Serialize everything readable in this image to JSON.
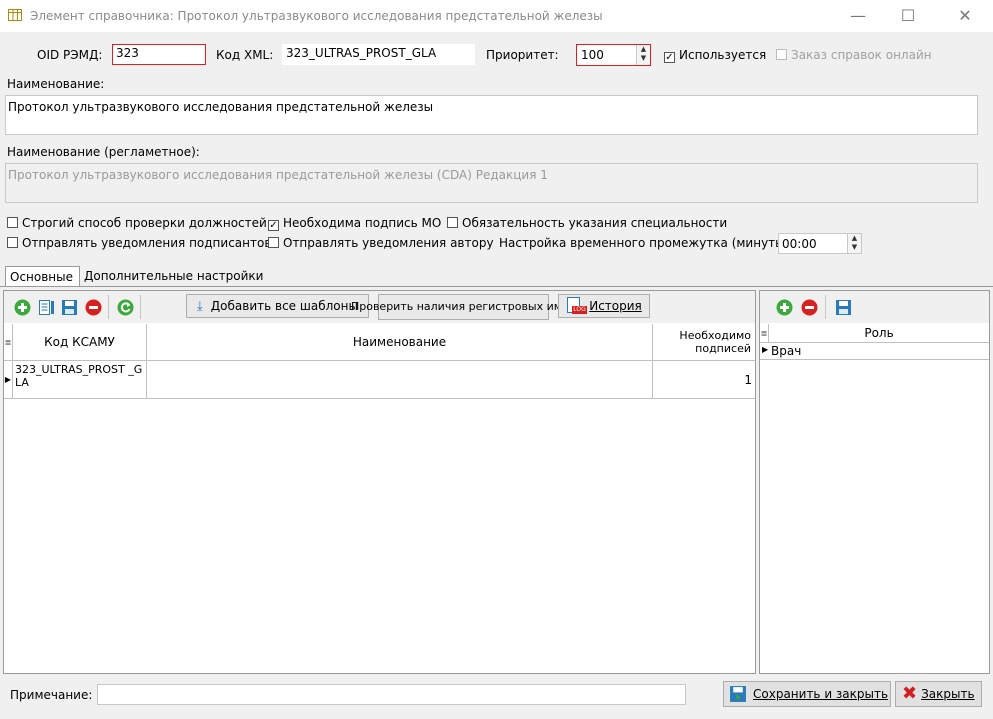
{
  "window": {
    "title": "Элемент справочника: Протокол ультразвукового исследования предстательной железы",
    "minimize": "—",
    "maximize": "☐",
    "close": "✕"
  },
  "header": {
    "oid_label": "OID РЭМД:",
    "oid_value": "323",
    "xml_label": "Код XML:",
    "xml_value": "323_ULTRAS_PROST_GLA",
    "priority_label": "Приоритет:",
    "priority_value": "100",
    "used_label": "Используется",
    "used_checked": true,
    "online_label": "Заказ справок онлайн",
    "online_checked": false
  },
  "name": {
    "label": "Наименование:",
    "value": "Протокол ультразвукового исследования предстательной железы"
  },
  "reg_name": {
    "label": "Наименование (регламетное):",
    "value": "Протокол ультразвукового исследования предстательной железы (CDA) Редакция 1"
  },
  "options": {
    "strict_check": "Строгий способ проверки должностей",
    "need_sign_mo": "Необходима подпись МО",
    "specialty_required": "Обязательность указания специальности",
    "notify_signers": "Отправлять уведомления подписантов",
    "notify_author": "Отправлять уведомления автору",
    "interval_label": "Настройка временного промежутка (минуты):",
    "interval_value": "00:00",
    "checked": {
      "need_sign_mo": true
    }
  },
  "tabs": [
    {
      "label": "Основные"
    },
    {
      "label": "Дополнительные настройки"
    }
  ],
  "toolbar": {
    "add_all_templates": "Добавить все шаблоны",
    "check_reg_names": "Проверить наличия регистровых имен",
    "history": "История",
    "history_badge": "LOG"
  },
  "main_grid": {
    "columns": [
      "Код КСАМУ",
      "Наименование",
      "Необходимо подписей"
    ],
    "rows": [
      {
        "code": "323_ULTRAS_PROST _GLA",
        "name": "",
        "signatures": "1"
      }
    ]
  },
  "role_grid": {
    "columns": [
      "Роль"
    ],
    "rows": [
      {
        "role": "Врач"
      }
    ]
  },
  "footer": {
    "note_label": "Примечание:",
    "note_value": "",
    "save_close": "Сохранить и закрыть",
    "close": "Закрыть"
  },
  "colors": {
    "error_border": "#e02020",
    "icon_green": "#3aaa3a",
    "icon_red": "#d8201f",
    "icon_blue": "#2a7ab8",
    "close_x_red": "#d21e1e"
  }
}
